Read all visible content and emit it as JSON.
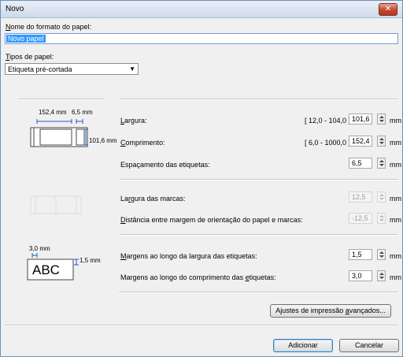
{
  "window": {
    "title": "Novo",
    "close_glyph": "✕"
  },
  "format_name": {
    "label_prefix": "N",
    "label_rest": "ome do formato do papel:",
    "value": "Novo papel"
  },
  "paper_type": {
    "label_prefix": "T",
    "label_rest": "ipos de papel:",
    "selected": "Etiqueta pré-cortada"
  },
  "dimensions_diagram": {
    "width_text": "152,4 mm",
    "gap_text": "6,5 mm",
    "height_text": "101,6 mm"
  },
  "fields": {
    "width": {
      "label_pre": "L",
      "label_rest": "argura:",
      "range": "[ 12,0 - 104,0 ]",
      "value": "101,6",
      "unit": "mm"
    },
    "length": {
      "label_pre": "C",
      "label_rest": "omprimento:",
      "range": "[ 6,0 - 1000,0 ]",
      "value": "152,4",
      "unit": "mm"
    },
    "spacing": {
      "label": "Espaçamento das etiquetas:",
      "value": "6,5",
      "unit": "mm"
    },
    "mark_width": {
      "label_pre": "La",
      "label_u": "r",
      "label_rest": "gura das marcas:",
      "value": "12,5",
      "unit": "mm"
    },
    "mark_distance": {
      "label_pre": "D",
      "label_rest": "istância entre margem de orientação do papel e marcas:",
      "value": "-12,5",
      "unit": "mm"
    },
    "margin_width": {
      "label_pre": "M",
      "label_rest": "argens ao longo da largura das etiquetas:",
      "value": "1,5",
      "unit": "mm"
    },
    "margin_length": {
      "label_a": "Margens ao longo do comprimento das ",
      "label_u": "e",
      "label_b": "tiquetas:",
      "value": "3,0",
      "unit": "mm"
    }
  },
  "margin_diagram": {
    "top_text": "3,0 mm",
    "side_text": "1,5 mm",
    "sample_text": "ABC"
  },
  "buttons": {
    "advanced_a": "Ajustes de impressão ",
    "advanced_u": "a",
    "advanced_b": "vançados...",
    "add": "Adicionar",
    "cancel": "Cancelar"
  }
}
